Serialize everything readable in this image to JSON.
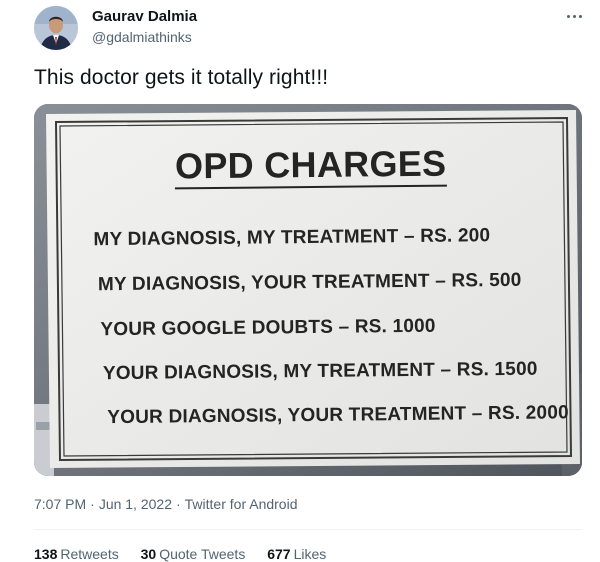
{
  "author": {
    "name": "Gaurav Dalmia",
    "handle": "@gdalmiathinks"
  },
  "tweet": {
    "text": "This doctor gets it totally right!!!"
  },
  "notice": {
    "title": "OPD CHARGES",
    "lines": [
      "MY DIAGNOSIS, MY TREATMENT – RS. 200",
      "MY DIAGNOSIS, YOUR TREATMENT – RS. 500",
      "YOUR GOOGLE DOUBTS – RS. 1000",
      "YOUR DIAGNOSIS, MY TREATMENT – RS. 1500",
      "YOUR DIAGNOSIS, YOUR TREATMENT – RS. 2000"
    ]
  },
  "meta": {
    "time": "7:07 PM",
    "date": "Jun 1, 2022",
    "source": "Twitter for Android"
  },
  "stats": {
    "retweets": {
      "count": "138",
      "label": "Retweets"
    },
    "quotes": {
      "count": "30",
      "label": "Quote Tweets"
    },
    "likes": {
      "count": "677",
      "label": "Likes"
    }
  },
  "icons": {
    "more": "more-dots-icon",
    "avatar": "profile-photo"
  },
  "colors": {
    "text": "#0f1419",
    "secondary": "#536471",
    "divider": "#eff3f4"
  }
}
